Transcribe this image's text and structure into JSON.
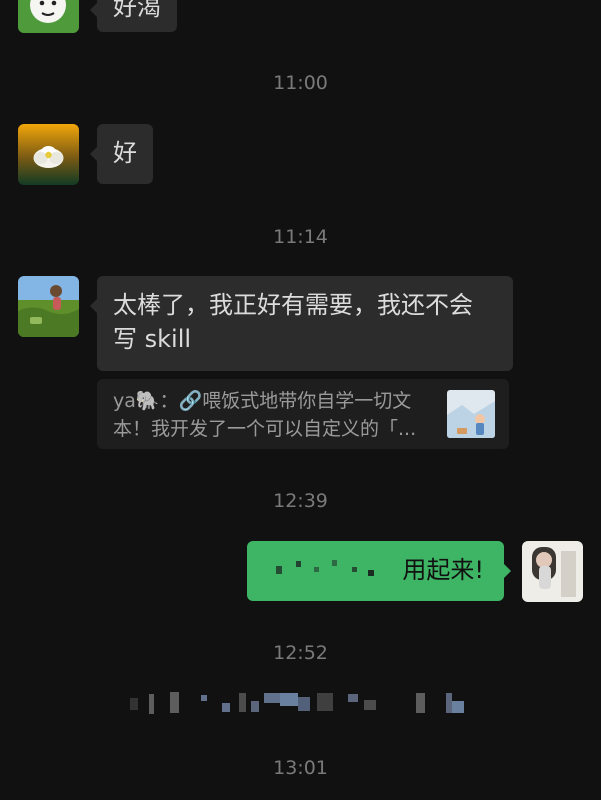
{
  "messages": [
    {
      "side": "left",
      "text": "好渴"
    },
    {
      "time": "11:00"
    },
    {
      "side": "left",
      "text": "好"
    },
    {
      "time": "11:14"
    },
    {
      "side": "left",
      "text_lines": [
        "太棒了，我正好有需要，我还不会",
        "写 skill"
      ]
    },
    {
      "quote": {
        "prefix": "ya🐘：",
        "line1": "喂饭式地带你自学一切文",
        "line2": "本！我开发了一个可以自定义的「..."
      }
    },
    {
      "time": "12:39"
    },
    {
      "side": "right",
      "text": "用起来!"
    },
    {
      "time": "12:52"
    },
    {
      "time": "13:01"
    }
  ],
  "colors": {
    "background": "#111111",
    "bubble_other": "#2c2c2c",
    "bubble_self": "#3eb565",
    "timestamp": "#7a7a7a"
  },
  "icons": [
    "link-icon",
    "elephant-emoji"
  ]
}
